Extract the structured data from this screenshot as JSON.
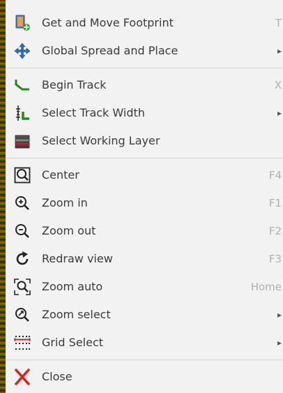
{
  "menu": {
    "items": [
      {
        "label": "Get and Move Footprint",
        "shortcut": "T",
        "icon": "footprint-move-icon"
      },
      {
        "label": "Global Spread and Place",
        "submenu": true,
        "icon": "spread-place-icon"
      },
      {
        "label": "Begin Track",
        "shortcut": "X",
        "icon": "track-icon"
      },
      {
        "label": "Select Track Width",
        "submenu": true,
        "icon": "track-width-icon"
      },
      {
        "label": "Select Working Layer",
        "icon": "layers-icon"
      },
      {
        "label": "Center",
        "shortcut": "F4",
        "icon": "zoom-center-icon"
      },
      {
        "label": "Zoom in",
        "shortcut": "F1",
        "icon": "zoom-in-icon"
      },
      {
        "label": "Zoom out",
        "shortcut": "F2",
        "icon": "zoom-out-icon"
      },
      {
        "label": "Redraw view",
        "shortcut": "F3",
        "icon": "redraw-icon"
      },
      {
        "label": "Zoom auto",
        "shortcut": "Home",
        "icon": "zoom-auto-icon"
      },
      {
        "label": "Zoom select",
        "submenu": true,
        "icon": "zoom-select-icon"
      },
      {
        "label": "Grid Select",
        "submenu": true,
        "icon": "grid-icon"
      },
      {
        "label": "Close",
        "icon": "close-icon"
      }
    ],
    "submenu_arrow": "▸"
  }
}
